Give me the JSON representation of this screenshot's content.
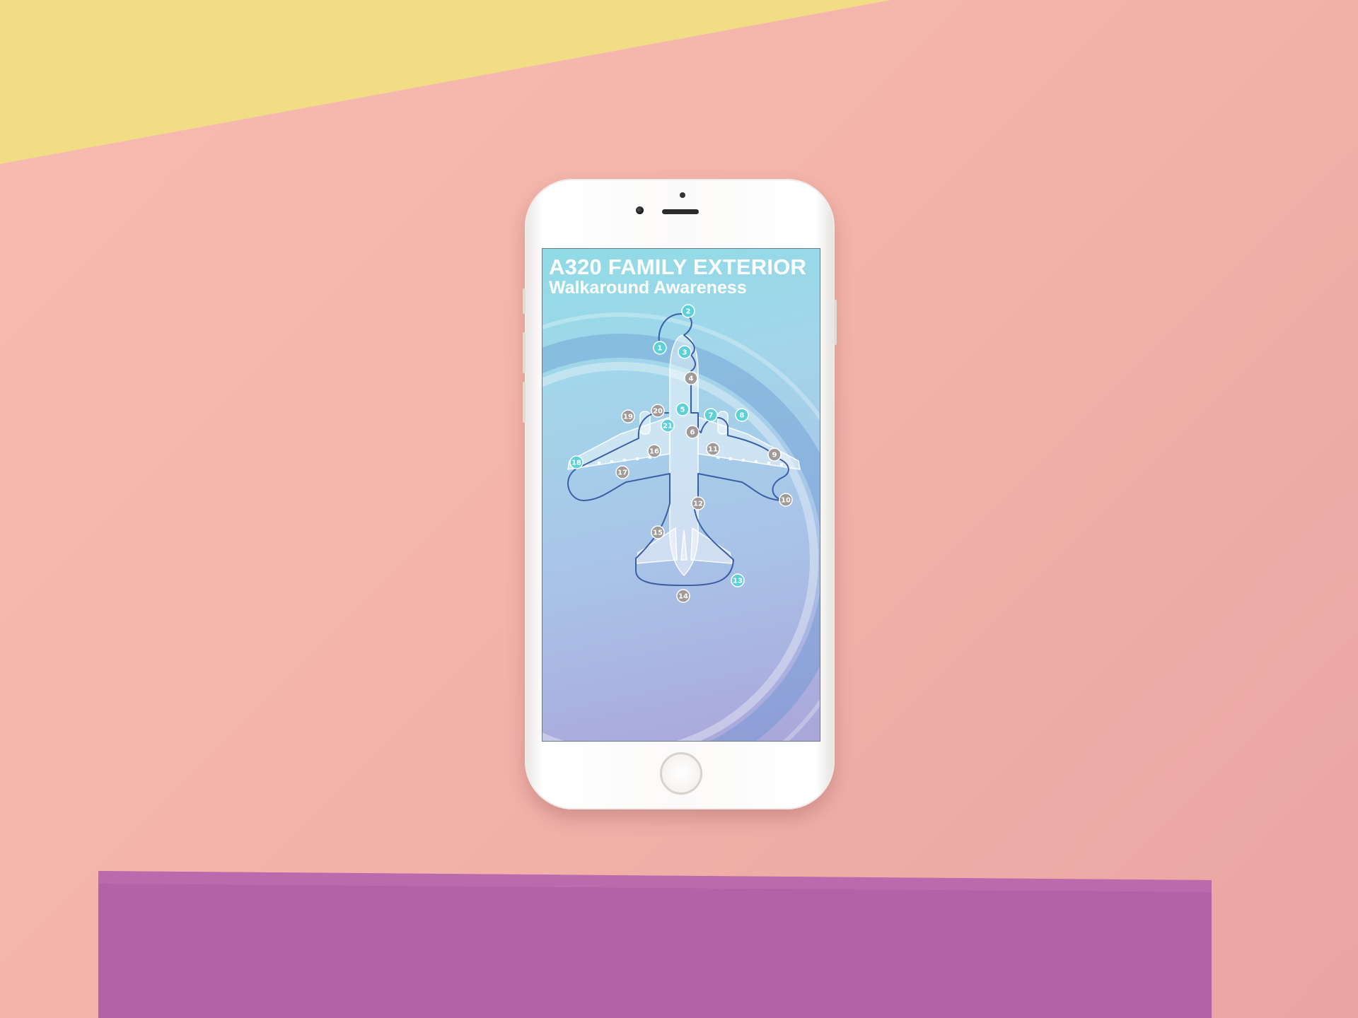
{
  "screen": {
    "title": "A320 FAMILY EXTERIOR",
    "subtitle": "Walkaround Awareness"
  },
  "walkaround": {
    "active_color": "#5ed0d8",
    "pending_color": "#a09a98",
    "route_color": "#3a5fa6",
    "points": [
      {
        "label": "1",
        "status": "active"
      },
      {
        "label": "2",
        "status": "active"
      },
      {
        "label": "3",
        "status": "active"
      },
      {
        "label": "4",
        "status": "pending"
      },
      {
        "label": "5",
        "status": "active"
      },
      {
        "label": "6",
        "status": "pending"
      },
      {
        "label": "7",
        "status": "active"
      },
      {
        "label": "8",
        "status": "active"
      },
      {
        "label": "9",
        "status": "pending"
      },
      {
        "label": "10",
        "status": "pending"
      },
      {
        "label": "11",
        "status": "pending"
      },
      {
        "label": "12",
        "status": "pending"
      },
      {
        "label": "13",
        "status": "active"
      },
      {
        "label": "14",
        "status": "pending"
      },
      {
        "label": "15",
        "status": "pending"
      },
      {
        "label": "16",
        "status": "pending"
      },
      {
        "label": "17",
        "status": "pending"
      },
      {
        "label": "18",
        "status": "active"
      },
      {
        "label": "19",
        "status": "pending"
      },
      {
        "label": "20",
        "status": "pending"
      },
      {
        "label": "21",
        "status": "active"
      }
    ]
  }
}
